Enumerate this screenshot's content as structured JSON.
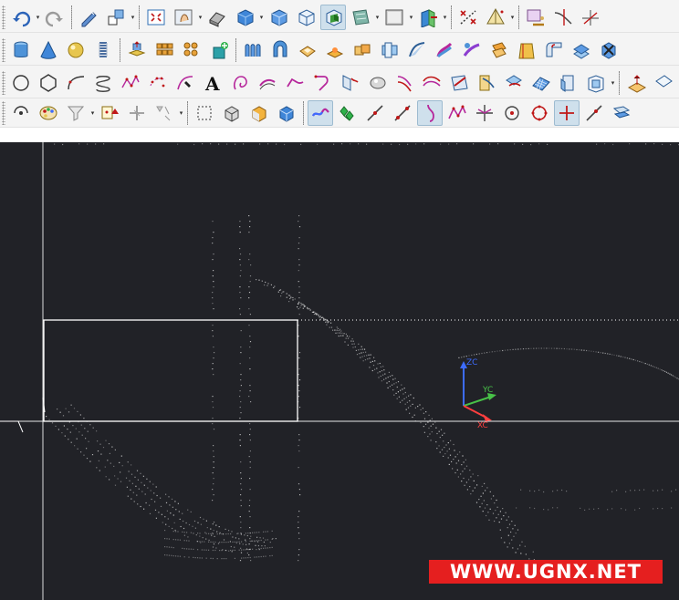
{
  "toolbars": {
    "row1": [
      "undo-arrow",
      "dropdown",
      "redo-arrow",
      "sep",
      "edit-object",
      "show-hide",
      "dropdown",
      "sep",
      "fit",
      "zoom-pan",
      "dropdown",
      "shaded-edges",
      "shaded",
      "dropdown",
      "wireframe",
      "static-wireframe",
      "partially-shaded",
      "face-analysis",
      "dropdown",
      "background",
      "dropdown",
      "section-view",
      "dropdown",
      "sep",
      "measure-distance",
      "measure-area",
      "dropdown",
      "sep",
      "datum-csys",
      "curve-trim",
      "datum-axis"
    ],
    "row2": [
      "cylinder",
      "cone",
      "sphere",
      "spring",
      "sep",
      "extrude-pad",
      "block-pattern",
      "pattern-feature",
      "point-constructor",
      "sep",
      "mirror-body",
      "revolve",
      "shell",
      "emboss",
      "boolean-unite",
      "boolean-subtract",
      "through-curves",
      "sweep",
      "swept-volume",
      "offset-face",
      "draft",
      "blend-face",
      "trim-body",
      "delete-face"
    ],
    "row3": [
      "circle",
      "polygon",
      "conic",
      "helix",
      "spline",
      "point-set",
      "fit-curve",
      "text",
      "law-curve",
      "offset-curve",
      "bridge-curve",
      "join-curve",
      "project-curve",
      "intersect-curve",
      "section-curve",
      "extract-curve",
      "isoparametric",
      "wrap-curve",
      "divide-face",
      "surface-grid",
      "combined-projection",
      "curve-on-surface",
      "dropdown",
      "sep",
      "datum-plane",
      "tangent"
    ],
    "row4": [
      "snap-options",
      "color-palette",
      "filter",
      "dropdown",
      "snap-mode",
      "snap-mode-2",
      "selection-box",
      "dropdown",
      "sep",
      "body-select",
      "face-select",
      "solid-select",
      "sheet-select",
      "sep",
      "end-point",
      "line-point",
      "arc-point",
      "curve-point",
      "control-point",
      "intersect-point",
      "arc-center",
      "quadrant-point",
      "existing-point",
      "point-on-curve",
      "point-on-surface",
      "grid"
    ],
    "pressed": [
      "partially-shaded",
      "end-point",
      "control-point",
      "point-on-curve"
    ]
  },
  "wcs": {
    "z_label": "ZC",
    "y_label": "YC",
    "x_label": "XC",
    "z_color": "#3d6cff",
    "y_color": "#48c248",
    "x_color": "#ff3f3f"
  },
  "watermark": {
    "text": "WWW.UGNX.NET",
    "background": "#e51f1f",
    "color": "#ffffff"
  },
  "colors": {
    "viewport_background": "#212227",
    "toolbar_background": "#f4f4f4",
    "geometry_lines": "#ffffff"
  }
}
